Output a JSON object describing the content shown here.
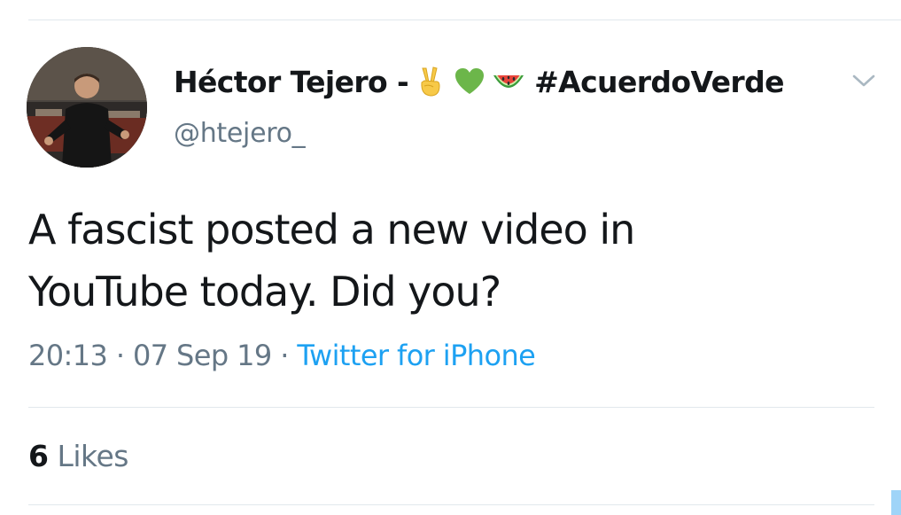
{
  "tweet": {
    "display_name": "Héctor Tejero -",
    "display_name_emojis": [
      "victory-hand-emoji",
      "green-heart-emoji",
      "watermelon-emoji"
    ],
    "hashtag": "#AcuerdoVerde",
    "handle": "@htejero_",
    "text_line1": "A fascist posted a new video in",
    "text_line2": "YouTube today. Did you?",
    "time": "20:13",
    "separator": "·",
    "date": "07 Sep 19",
    "source": "Twitter for iPhone",
    "likes_count": "6",
    "likes_label": "Likes"
  },
  "icons": {
    "menu": "chevron-down-icon",
    "avatar": "profile-photo"
  },
  "colors": {
    "text_primary": "#14171a",
    "text_secondary": "#657786",
    "link_blue": "#1da1f2",
    "divider": "#e1e8ed"
  }
}
